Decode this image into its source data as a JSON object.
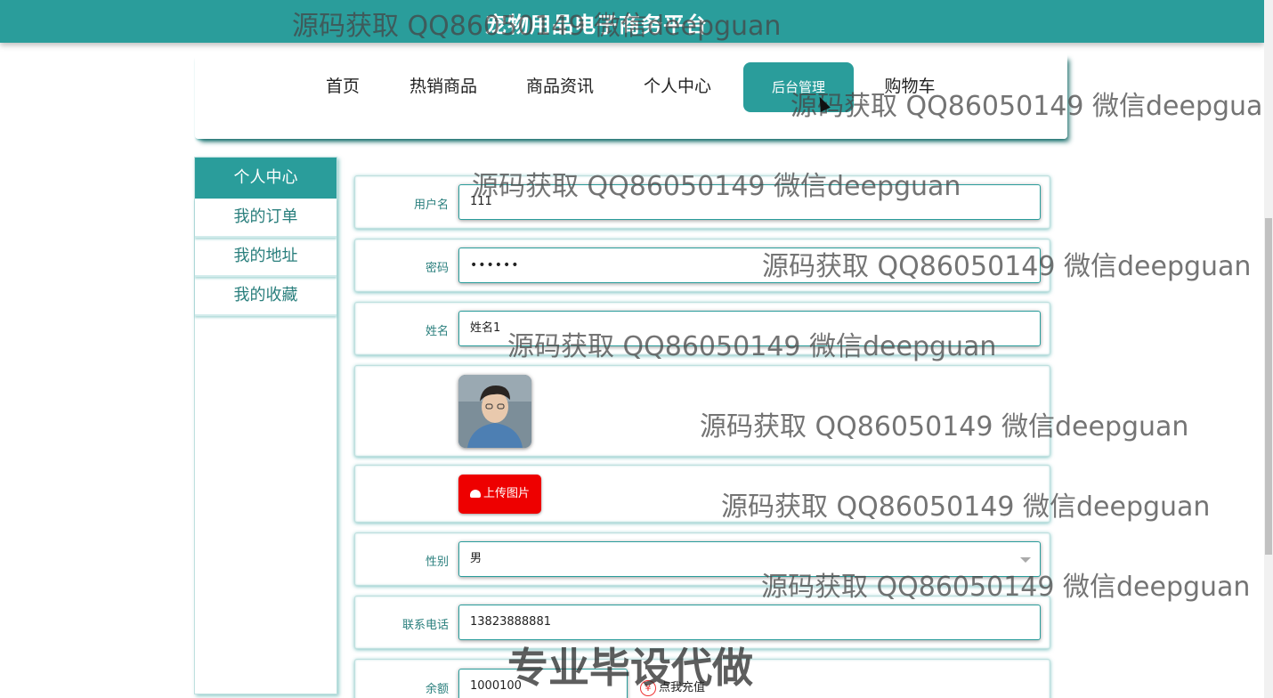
{
  "header": {
    "site_title": "宠物用品电子商务平台"
  },
  "nav": {
    "items": [
      {
        "label": "首页"
      },
      {
        "label": "热销商品"
      },
      {
        "label": "商品资讯"
      },
      {
        "label": "个人中心"
      },
      {
        "label": "后台管理",
        "active": true
      },
      {
        "label": "购物车"
      }
    ]
  },
  "sidebar": {
    "title": "个人中心",
    "items": [
      {
        "label": "我的订单"
      },
      {
        "label": "我的地址"
      },
      {
        "label": "我的收藏"
      }
    ]
  },
  "form": {
    "username": {
      "label": "用户名",
      "value": "111"
    },
    "password": {
      "label": "密码",
      "value": "••••••"
    },
    "name": {
      "label": "姓名",
      "value": "姓名1"
    },
    "upload": {
      "label": "上传图片"
    },
    "gender": {
      "label": "性别",
      "value": "男"
    },
    "phone": {
      "label": "联系电话",
      "value": "13823888881"
    },
    "balance": {
      "label": "余额",
      "value": "1000100",
      "recharge_label": "点我充值",
      "recharge_icon": "¥"
    }
  },
  "watermarks": {
    "text": "源码获取 QQ86050149 微信deepguan",
    "banner": "专业毕设代做"
  },
  "colors": {
    "accent": "#2a9d9b",
    "upload_button": "#ee0000"
  }
}
